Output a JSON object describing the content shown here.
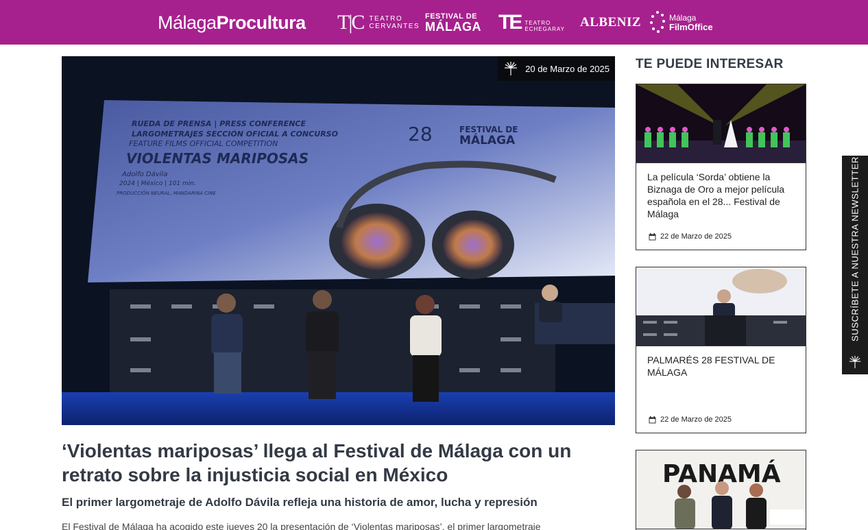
{
  "header": {
    "brand_thin": "Málaga",
    "brand_bold": "Procultura",
    "partners": {
      "tc_mark": "T|C",
      "tc_line1": "TEATRO",
      "tc_line2": "CERVANTES",
      "fm_line1": "FESTIVAL DE",
      "fm_line2": "MÁLAGA",
      "te_mark": "TE",
      "te_line1": "TEATRO",
      "te_line2": "ECHEGARAY",
      "albeniz": "ALBENIZ",
      "mfo_line1": "Málaga",
      "mfo_line2": "FilmOffice"
    },
    "bg_color": "#a7218e"
  },
  "article": {
    "date": "20 de Marzo de 2025",
    "title": "‘Violentas mariposas’ llega al Festival de Málaga con un retrato sobre la injusticia social en México",
    "subtitle": "El primer largometraje de Adolfo Dávila refleja una historia de amor, lucha y represión",
    "body_start": "El Festival de Málaga ha acogido este jueves 20 la presentación de ‘Violentas mariposas’, el primer largometraje"
  },
  "hero_screen": {
    "line1": "RUEDA DE PRENSA | PRESS CONFERENCE",
    "line2": "LARGOMETRAJES SECCIÓN OFICIAL A CONCURSO",
    "line3": "FEATURE FILMS OFFICIAL COMPETITION",
    "film": "VIOLENTAS MARIPOSAS",
    "director": "Adolfo Dávila",
    "details": "2024 | México | 101 min.",
    "production": "PRODUCCIÓN NEURAL, MANDARINA CINE",
    "festival_num": "28",
    "festival_l1": "FESTIVAL DE",
    "festival_l2": "MÁLAGA"
  },
  "sidebar": {
    "title": "TE PUEDE INTERESAR",
    "cards": [
      {
        "title": "La película ‘Sorda’ obtiene la Biznaga de Oro a mejor película española en el 28... Festival de Málaga",
        "date": "22 de Marzo de 2025"
      },
      {
        "title": "PALMARÉS 28 FESTIVAL DE MÁLAGA",
        "date": "22 de Marzo de 2025"
      },
      {
        "title": "",
        "date": "",
        "thumb_text": "PANAMÁ"
      }
    ]
  },
  "newsletter": {
    "label": "SUSCRÍBETE A NUESTRA NEWSLETTER"
  },
  "icons": [
    "biznaga-icon",
    "calendar-icon"
  ]
}
